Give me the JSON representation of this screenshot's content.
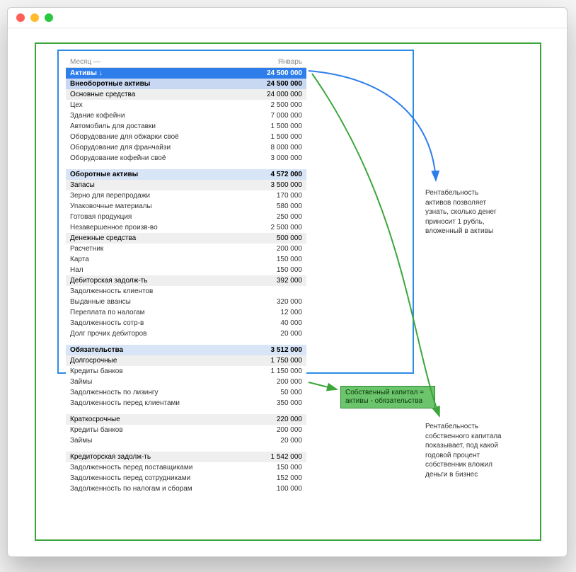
{
  "header": {
    "month_label": "Месяц —",
    "month_value": "Январь"
  },
  "sections": {
    "assets": {
      "label": "Активы ↓",
      "value": "24 500 000"
    },
    "noncurrent": {
      "label": "Внеоборотные активы",
      "value": "24 500 000"
    },
    "fixed": {
      "label": "Основные средства",
      "value": "24 000 000"
    },
    "rows_fixed": [
      {
        "label": "Цех",
        "value": "2 500 000"
      },
      {
        "label": "Здание кофейни",
        "value": "7 000 000"
      },
      {
        "label": "Автомобиль для доставки",
        "value": "1 500 000"
      },
      {
        "label": "Оборудование для обжарки своё",
        "value": "1 500 000"
      },
      {
        "label": "Оборудование для франчайзи",
        "value": "8 000 000"
      },
      {
        "label": "Оборудование кофейни своё",
        "value": "3 000 000"
      }
    ],
    "current": {
      "label": "Оборотные активы",
      "value": "4 572 000"
    },
    "inventory": {
      "label": "Запасы",
      "value": "3 500 000"
    },
    "rows_inv": [
      {
        "label": "Зерно для перепродажи",
        "value": "170 000"
      },
      {
        "label": "Упаковочные материалы",
        "value": "580 000"
      },
      {
        "label": "Готовая продукция",
        "value": "250 000"
      },
      {
        "label": "Незавершенное произв-во",
        "value": "2 500 000"
      }
    ],
    "cash": {
      "label": "Денежные средства",
      "value": "500 000"
    },
    "rows_cash": [
      {
        "label": "Расчетник",
        "value": "200 000"
      },
      {
        "label": "Карта",
        "value": "150 000"
      },
      {
        "label": "Нал",
        "value": "150 000"
      }
    ],
    "receivables": {
      "label": "Дебиторская задолж-ть",
      "value": "392 000"
    },
    "rows_recv": [
      {
        "label": "Задолженность клиентов",
        "value": ""
      },
      {
        "label": "Выданные авансы",
        "value": "320 000"
      },
      {
        "label": "Переплата по налогам",
        "value": "12 000"
      },
      {
        "label": "Задолженность сотр-в",
        "value": "40 000"
      },
      {
        "label": "Долг прочих дебиторов",
        "value": "20 000"
      }
    ],
    "liab": {
      "label": "Обязательства",
      "value": "3 512 000"
    },
    "long": {
      "label": "Долгосрочные",
      "value": "1 750 000"
    },
    "rows_long": [
      {
        "label": "Кредиты банков",
        "value": "1 150 000"
      },
      {
        "label": "Займы",
        "value": "200 000"
      },
      {
        "label": "Задолженность по лизингу",
        "value": "50 000"
      },
      {
        "label": "Задолженность перед клиентами",
        "value": "350 000"
      }
    ],
    "short": {
      "label": "Краткосрочные",
      "value": "220 000"
    },
    "rows_short": [
      {
        "label": "Кредиты банков",
        "value": "200 000"
      },
      {
        "label": "Займы",
        "value": "20 000"
      }
    ],
    "payables": {
      "label": "Кредиторская задолж-ть",
      "value": "1 542 000"
    },
    "rows_pay": [
      {
        "label": "Задолженность перед поставщиками",
        "value": "150 000"
      },
      {
        "label": "Задолженность перед сотрудниками",
        "value": "152 000"
      },
      {
        "label": "Задолженность по налогам и сборам",
        "value": "100 000"
      }
    ]
  },
  "notes": {
    "top": "Рентабельность активов позволяет узнать, сколько денег приносит 1 рубль, вложенный в активы",
    "bot": "Рентабельность собственного капитала показывает, под какой годовой процент собственник вложил деньги в бизнес",
    "pill": "Собственный капитал = активы - обязательства"
  }
}
